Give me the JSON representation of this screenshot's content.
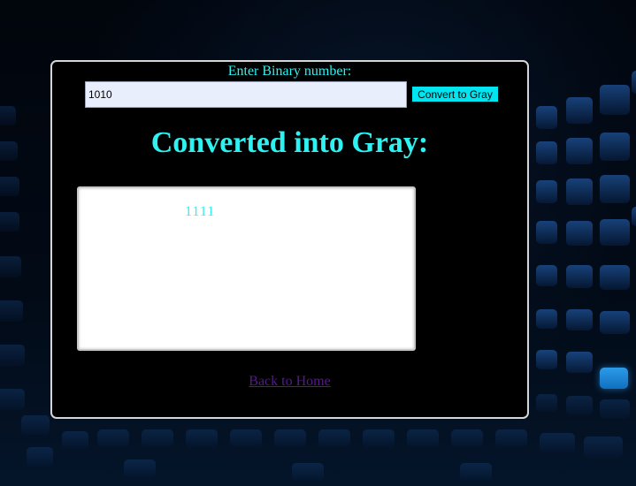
{
  "form": {
    "prompt_label": "Enter Binary number:",
    "input_value": "1010",
    "button_label": "Convert to Gray"
  },
  "result": {
    "heading": "Converted into Gray:",
    "value": "1111"
  },
  "nav": {
    "back_link": "Back to Home"
  },
  "colors": {
    "accent": "#2ef1f1",
    "button_bg": "#00e5f0",
    "link": "#551a8b",
    "panel_border": "#d6d6d6"
  }
}
